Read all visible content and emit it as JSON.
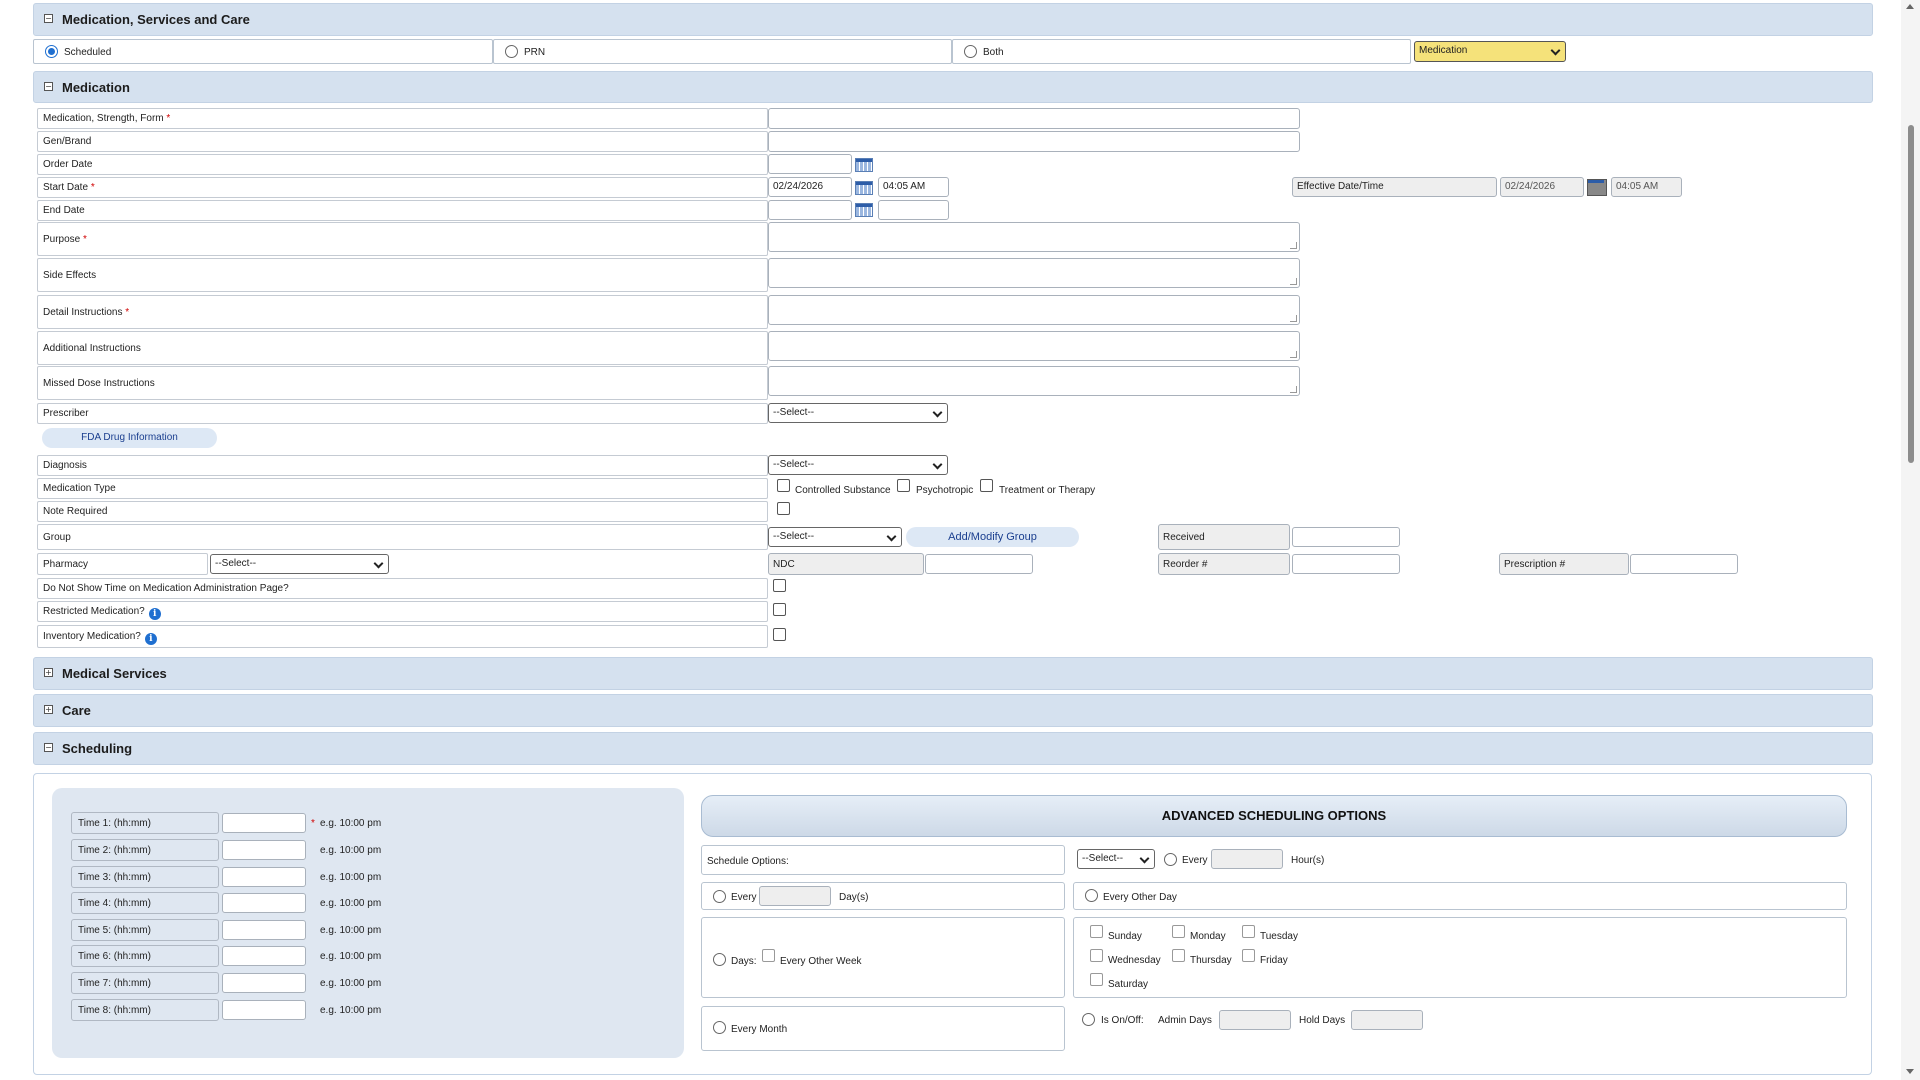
{
  "sections": {
    "medication_services_care": "Medication, Services and Care",
    "medication": "Medication",
    "medical_services": "Medical Services",
    "care": "Care",
    "scheduling": "Scheduling"
  },
  "schedule_type": {
    "scheduled": "Scheduled",
    "prn": "PRN",
    "both": "Both",
    "category_select": "Medication"
  },
  "fields": {
    "med_strength_form": "Medication, Strength, Form",
    "gen_brand": "Gen/Brand",
    "order_date": "Order Date",
    "start_date": "Start Date",
    "start_date_value": "02/24/2026",
    "start_time_value": "04:05 AM",
    "effective_label": "Effective Date/Time",
    "effective_date_value": "02/24/2026",
    "effective_time_value": "04:05 AM",
    "end_date": "End Date",
    "purpose": "Purpose",
    "side_effects": "Side Effects",
    "detail_instructions": "Detail Instructions",
    "additional_instructions": "Additional Instructions",
    "missed_dose": "Missed Dose Instructions",
    "prescriber": "Prescriber",
    "prescriber_select": "--Select--",
    "fda_button": "FDA Drug Information",
    "diagnosis": "Diagnosis",
    "diagnosis_select": "--Select--",
    "medication_type": "Medication Type",
    "controlled": "Controlled Substance",
    "psychotropic": "Psychotropic",
    "treatment": "Treatment or Therapy",
    "note_required": "Note Required",
    "group": "Group",
    "group_select": "--Select--",
    "add_modify_group": "Add/Modify Group",
    "received": "Received",
    "pharmacy": "Pharmacy",
    "pharmacy_select": "--Select--",
    "ndc": "NDC",
    "reorder": "Reorder #",
    "prescription": "Prescription #",
    "do_not_show_time": "Do Not Show Time on Medication Administration Page?",
    "restricted": "Restricted Medication?",
    "inventory": "Inventory Medication?",
    "required_mark": "*",
    "info_glyph": "i"
  },
  "times": [
    {
      "label": "Time 1: (hh:mm)",
      "hint": "e.g. 10:00 pm",
      "required": "*"
    },
    {
      "label": "Time 2: (hh:mm)",
      "hint": "e.g. 10:00 pm",
      "required": ""
    },
    {
      "label": "Time 3: (hh:mm)",
      "hint": "e.g. 10:00 pm",
      "required": ""
    },
    {
      "label": "Time 4: (hh:mm)",
      "hint": "e.g. 10:00 pm",
      "required": ""
    },
    {
      "label": "Time 5: (hh:mm)",
      "hint": "e.g. 10:00 pm",
      "required": ""
    },
    {
      "label": "Time 6: (hh:mm)",
      "hint": "e.g. 10:00 pm",
      "required": ""
    },
    {
      "label": "Time 7: (hh:mm)",
      "hint": "e.g. 10:00 pm",
      "required": ""
    },
    {
      "label": "Time 8: (hh:mm)",
      "hint": "e.g. 10:00 pm",
      "required": ""
    }
  ],
  "advanced": {
    "title": "ADVANCED SCHEDULING OPTIONS",
    "schedule_options": "Schedule Options:",
    "select": "--Select--",
    "every": "Every",
    "hours": "Hour(s)",
    "days_label": "Day(s)",
    "every_other_day": "Every Other Day",
    "days": "Days:",
    "every_other_week": "Every Other Week",
    "weekdays": [
      "Sunday",
      "Monday",
      "Tuesday",
      "Wednesday",
      "Thursday",
      "Friday",
      "Saturday"
    ],
    "every_month": "Every Month",
    "is_on_off": "Is On/Off:",
    "admin_days": "Admin Days",
    "hold_days": "Hold Days"
  },
  "toggle_glyphs": {
    "expanded": "−",
    "collapsed": "+"
  }
}
